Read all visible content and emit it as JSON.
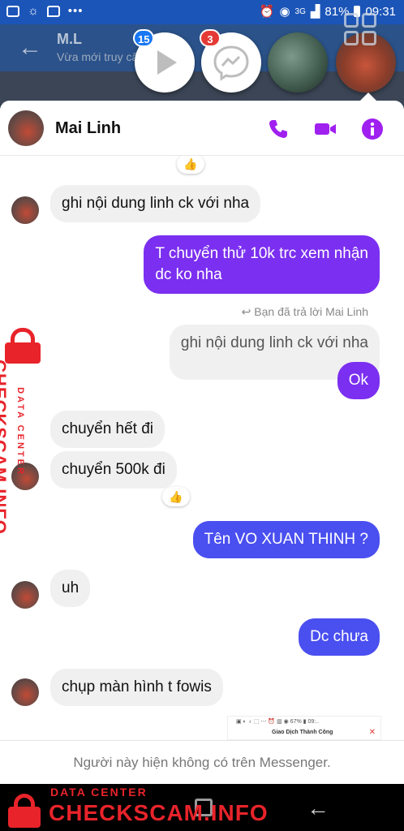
{
  "status_bar": {
    "battery": "81%",
    "time": "09:31",
    "network": "3G"
  },
  "background_app": {
    "title": "M.L",
    "subtitle": "Vừa mới truy cậ"
  },
  "chat_heads": {
    "play_badge": "15",
    "messenger_badge": "3"
  },
  "chat": {
    "contact_name": "Mai Linh",
    "colors": {
      "accent": "#7b2ff0",
      "accent_blue": "#4a4ff0",
      "header_icons": "#a020f0"
    },
    "messages": [
      {
        "id": "m1",
        "from": "them",
        "text": "ghi nội dung linh ck với nha"
      },
      {
        "id": "m2",
        "from": "me",
        "line1": "T chuyển thử 10k trc xem nhận",
        "line2": "dc ko nha"
      },
      {
        "id": "m3",
        "reply_note": "Bạn đã trả lời Mai Linh",
        "quoted": "ghi nội dung linh ck với nha",
        "text": "Ok"
      },
      {
        "id": "m4",
        "from": "them",
        "text": "chuyển hết đi"
      },
      {
        "id": "m5",
        "from": "them",
        "text": "chuyển 500k đi"
      },
      {
        "id": "m6",
        "from": "me",
        "text": "Tên VO XUAN THINH ?"
      },
      {
        "id": "m7",
        "from": "them",
        "text": "uh"
      },
      {
        "id": "m8",
        "from": "me",
        "text": "Dc chưa"
      },
      {
        "id": "m9",
        "from": "them",
        "text": "chụp màn hình t fowis"
      }
    ],
    "reaction": "👍",
    "preview_status": "▣ ◐ ♁ ⬚ ⋯    ⏰ ▥ ◉ 67% ▮ 09:..",
    "preview_title": "Giao Dịch Thành Công",
    "preview_close": "✕",
    "notice": "Người này hiện không có trên Messenger."
  },
  "watermark": {
    "small": "DATA CENTER",
    "large": "CHECKSCAM.INFO"
  }
}
